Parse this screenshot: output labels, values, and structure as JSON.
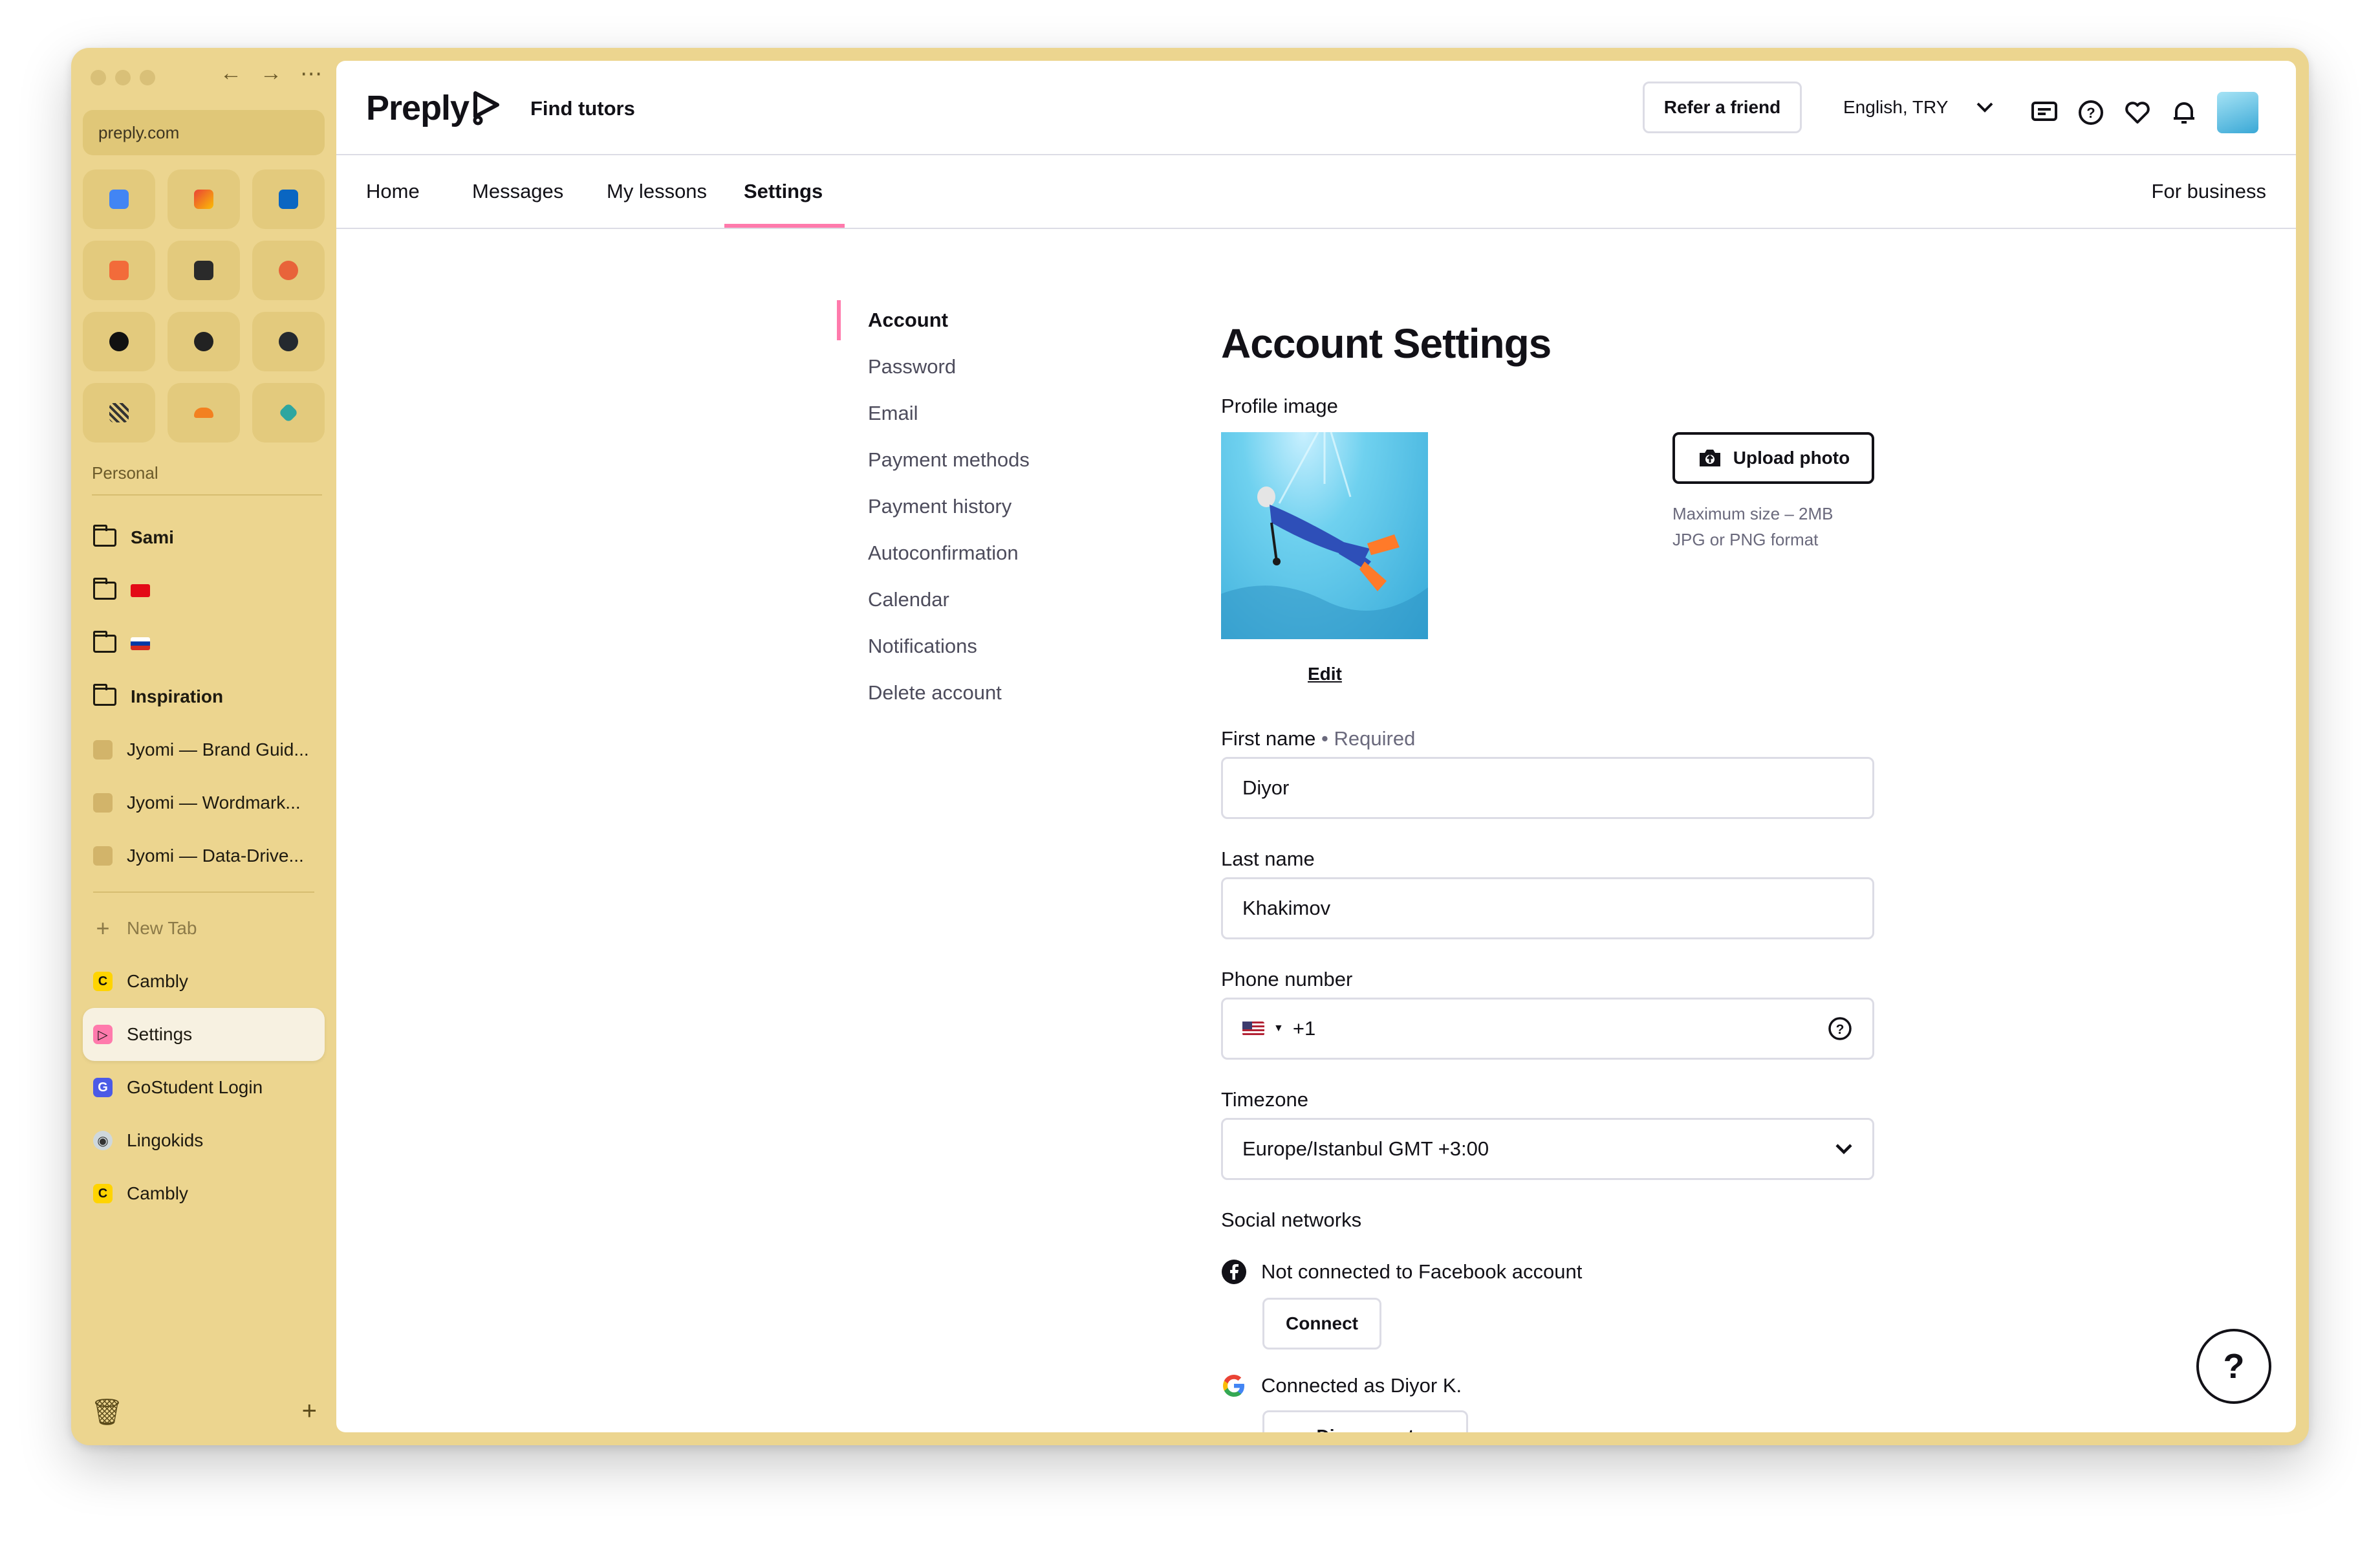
{
  "browser": {
    "url": "preply.com",
    "section_label": "Personal",
    "folders": [
      {
        "label": "Sami",
        "bold": true
      },
      {
        "label": "",
        "flag": "turkey"
      },
      {
        "label": "",
        "flag": "russia"
      },
      {
        "label": "Inspiration",
        "bold": true
      }
    ],
    "inspiration_items": [
      "Jyomi — Brand Guid...",
      "Jyomi — Wordmark...",
      "Jyomi — Data-Drive..."
    ],
    "new_tab_label": "New Tab",
    "tabs": [
      {
        "label": "Cambly",
        "icon": "cambly-icon"
      },
      {
        "label": "Settings",
        "icon": "preply-icon",
        "active": true
      },
      {
        "label": "GoStudent Login",
        "icon": "gostudent-icon"
      },
      {
        "label": "Lingokids",
        "icon": "lingokids-icon"
      },
      {
        "label": "Cambly",
        "icon": "cambly-icon"
      }
    ]
  },
  "header": {
    "logo": "Preply",
    "find_tutors": "Find tutors",
    "refer": "Refer a friend",
    "language": "English, TRY"
  },
  "nav": {
    "tabs": [
      "Home",
      "Messages",
      "My lessons",
      "Settings"
    ],
    "active_tab": "Settings",
    "business": "For business"
  },
  "settings_menu": [
    "Account",
    "Password",
    "Email",
    "Payment methods",
    "Payment history",
    "Autoconfirmation",
    "Calendar",
    "Notifications",
    "Delete account"
  ],
  "account": {
    "title": "Account Settings",
    "profile_image_label": "Profile image",
    "edit": "Edit",
    "upload": "Upload photo",
    "upload_note_1": "Maximum size – 2MB",
    "upload_note_2": "JPG or PNG format",
    "first_name_label": "First name",
    "required": "• Required",
    "first_name": "Diyor",
    "last_name_label": "Last name",
    "last_name": "Khakimov",
    "phone_label": "Phone number",
    "phone_code": "+1",
    "timezone_label": "Timezone",
    "timezone": "Europe/Istanbul GMT +3:00",
    "social_label": "Social networks",
    "facebook_status": "Not connected to Facebook account",
    "connect": "Connect",
    "google_status": "Connected as Diyor K.",
    "disconnect": "Disconnect"
  },
  "help": "?",
  "colors": {
    "accent": "#ff7aac",
    "sidebar": "#ecd58f",
    "text": "#121117"
  }
}
